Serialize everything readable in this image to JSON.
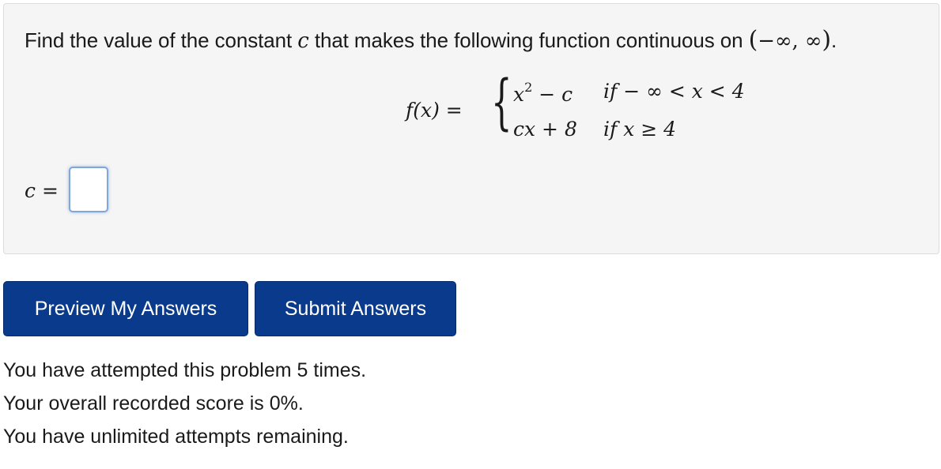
{
  "problem": {
    "prompt_before": "Find the value of the constant",
    "constant_symbol": "c",
    "prompt_after": "that makes the following function continuous on",
    "interval": "−∞, ∞",
    "period": ".",
    "function_lhs": "f(x) =",
    "case1_expr_base": "x",
    "case1_expr_exp": "2",
    "case1_expr_rest": " − c",
    "case1_condition": "if − ∞ < x < 4",
    "case2_expr": "cx + 8",
    "case2_condition": "if x ≥ 4"
  },
  "answer": {
    "label": "c =",
    "value": "",
    "placeholder": ""
  },
  "buttons": {
    "preview_label": "Preview My Answers",
    "submit_label": "Submit Answers"
  },
  "status": {
    "attempts": "You have attempted this problem 5 times.",
    "score": "Your overall recorded score is 0%.",
    "remaining": "You have unlimited attempts remaining."
  },
  "colors": {
    "button_bg": "#0a3a8c",
    "panel_bg": "#f5f5f5",
    "input_focus_border": "#7fa7d9"
  }
}
